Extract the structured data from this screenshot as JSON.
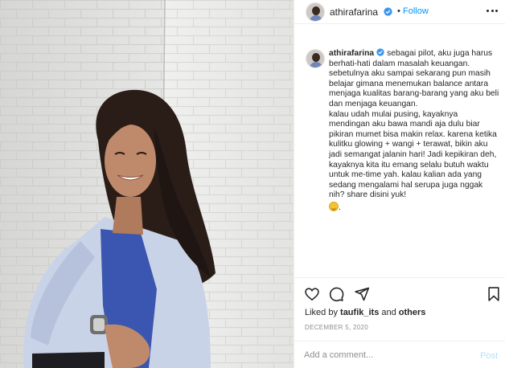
{
  "post": {
    "image_alt": "Woman smiling, sitting against a white brick wall",
    "username": "athirafarina",
    "dot": "•",
    "follow_label": "Follow",
    "caption_username": "athirafarina",
    "caption_text": "sebagai pilot, aku juga harus berhati-hati dalam masalah keuangan. sebetulnya aku sampai sekarang pun masih belajar gimana menemukan balance antara menjaga kualitas barang-barang yang aku beli dan menjaga keuangan.\nkalau udah mulai pusing, kayaknya mendingan aku bawa mandi aja dulu biar pikiran mumet bisa makin relax. karena ketika kulitku glowing + wangi + terawat, bikin aku jadi semangat jalanin hari! Jadi kepikiran deh, kayaknya kita itu emang selalu butuh waktu untuk me-time yah. kalau kalian ada yang sedang mengalami hal serupa juga nggak nih? share disini yuk!",
    "caption_end": ".",
    "liked_prefix": "Liked by ",
    "liked_user": "taufik_its",
    "liked_mid": " and ",
    "liked_others": "others",
    "date": "DECEMBER 5, 2020",
    "comment_placeholder": "Add a comment...",
    "post_label": "Post"
  },
  "colors": {
    "accent": "#0095f6",
    "post_disabled": "#b2dffc",
    "muted": "#8e8e8e",
    "text": "#262626"
  },
  "icons": [
    "verified-badge-icon",
    "more-options-icon",
    "heart-icon",
    "comment-icon",
    "share-icon",
    "bookmark-icon",
    "smile-emoji-icon"
  ]
}
